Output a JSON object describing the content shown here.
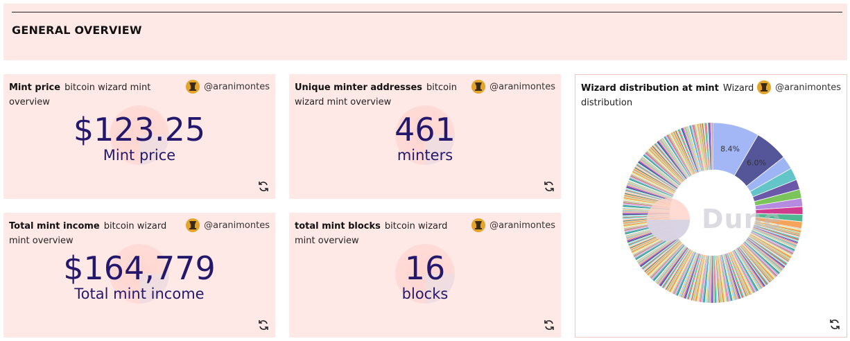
{
  "header": {
    "title": "GENERAL OVERVIEW"
  },
  "cards": [
    {
      "title_bold": "Mint price",
      "title_rest": "bitcoin wizard mint overview",
      "author": "@aranimontes",
      "value": "$123.25",
      "label": "Mint price"
    },
    {
      "title_bold": "Unique minter addresses",
      "title_rest": "bitcoin wizard mint overview",
      "author": "@aranimontes",
      "value": "461",
      "label": "minters"
    },
    {
      "title_bold": "Total mint income",
      "title_rest": "bitcoin wizard mint overview",
      "author": "@aranimontes",
      "value": "$164,779",
      "label": "Total mint income"
    },
    {
      "title_bold": "total mint blocks",
      "title_rest": "bitcoin wizard mint overview",
      "author": "@aranimontes",
      "value": "16",
      "label": "blocks"
    }
  ],
  "pie_card": {
    "title_bold": "Wizard distribution at mint",
    "title_rest": "Wizard distribution",
    "author": "@aranimontes",
    "watermark": "Dune"
  },
  "chart_data": {
    "type": "pie",
    "donut": true,
    "title": "Wizard distribution at mint",
    "slice_labels": [
      "8.4%",
      "6.0%"
    ],
    "values": [
      8.4,
      6.0,
      2.4,
      2.2,
      1.8,
      1.6,
      1.5,
      1.4,
      1.3,
      1.2
    ],
    "remaining_share_percent": 72.2,
    "remaining_slices_approx": 440,
    "colors": [
      "#a3b6f5",
      "#55559a",
      "#9db5f4",
      "#63c5c8",
      "#6b58a8",
      "#7ac45a",
      "#b58be0",
      "#d13b8e",
      "#50b890",
      "#f5a55a"
    ]
  },
  "icons": {
    "refresh": "refresh-icon",
    "avatar": "wizard-avatar-icon"
  }
}
